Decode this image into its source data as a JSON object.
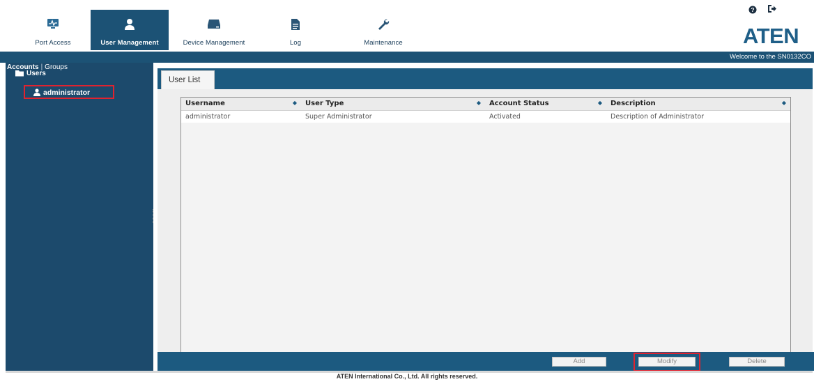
{
  "nav": {
    "tabs": [
      {
        "label": "Port Access",
        "icon": "monitor-icon"
      },
      {
        "label": "User Management",
        "icon": "user-icon",
        "active": true
      },
      {
        "label": "Device Management",
        "icon": "device-icon"
      },
      {
        "label": "Log",
        "icon": "document-icon"
      },
      {
        "label": "Maintenance",
        "icon": "wrench-icon"
      }
    ],
    "top_icons": [
      "help-icon",
      "logout-icon"
    ],
    "logo": "ATEN"
  },
  "header": {
    "welcome": "Welcome to the SN0132CO"
  },
  "sidebar": {
    "subtabs": [
      "Accounts",
      "Groups"
    ],
    "tree": {
      "root": "Users",
      "items": [
        "administrator"
      ]
    }
  },
  "main": {
    "tab_label": "User List",
    "table": {
      "columns": [
        "Username",
        "User Type",
        "Account Status",
        "Description"
      ],
      "rows": [
        [
          "administrator",
          "Super Administrator",
          "Activated",
          "Description of Administrator"
        ]
      ]
    }
  },
  "footer": {
    "buttons": {
      "add": "Add",
      "modify": "Modify",
      "delete": "Delete"
    },
    "copyright": "ATEN International Co., Ltd. All rights reserved."
  },
  "colors": {
    "nav_active": "#1c5275",
    "sidebar": "#1c4a6c",
    "panel_bar": "#1c5a80",
    "highlight": "#e0232f"
  }
}
